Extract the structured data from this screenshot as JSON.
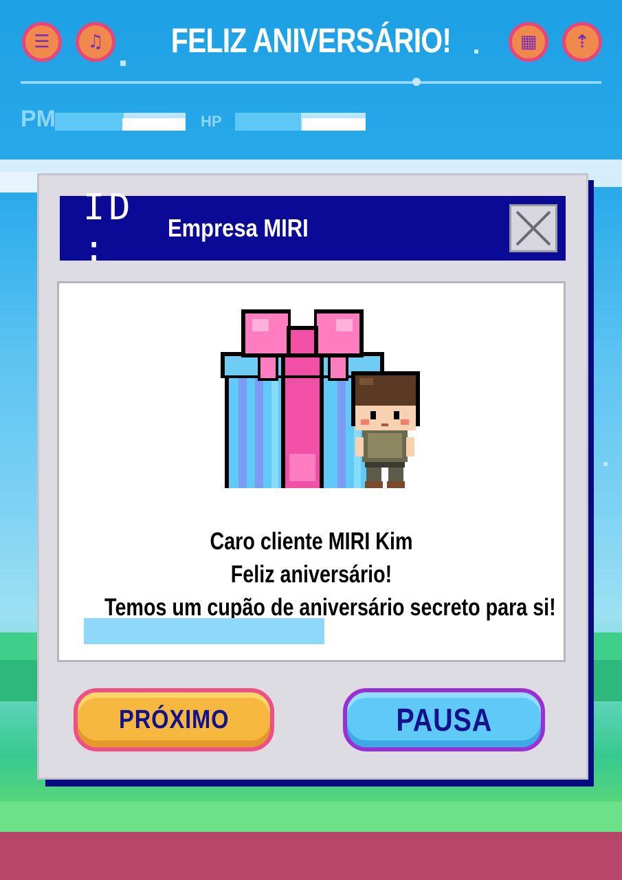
{
  "header": {
    "title": "FELIZ ANIVERSÁRIO!",
    "left_icons": [
      "list-icon",
      "music-icon"
    ],
    "right_icons": [
      "grid-icon",
      "upload-icon"
    ]
  },
  "stats": {
    "pm_label": "PM",
    "hp_label": "HP"
  },
  "window": {
    "id_label": "ID :",
    "company": "Empresa MIRI",
    "message": {
      "line1": "Caro cliente MIRI Kim",
      "line2": "Feliz aniversário!",
      "line3": "Temos um cupão de aniversário secreto para si!"
    }
  },
  "buttons": {
    "next_label": "PRÓXIMO",
    "pause_label": "PAUSA"
  },
  "colors": {
    "sky": "#1da0e4",
    "titlebar": "#0a0a96",
    "gift_pink": "#f24fa6",
    "gift_blue": "#5fc9f7",
    "next_button": "#f7b840",
    "pause_button": "#5fc9f7"
  }
}
